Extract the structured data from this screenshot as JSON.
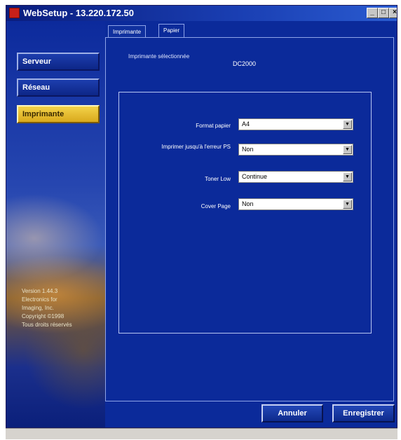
{
  "window": {
    "title": "WebSetup - 13.220.172.50",
    "controls": [
      "_",
      "□",
      "×"
    ]
  },
  "sidebar": {
    "items": [
      {
        "label": "Serveur",
        "active": false
      },
      {
        "label": "Réseau",
        "active": false
      },
      {
        "label": "Imprimante",
        "active": true
      }
    ],
    "info_lines": [
      "Version 1.44.3",
      "Electronics for",
      "Imaging, Inc.",
      "Copyright ©1998",
      "Tous droits réservés"
    ]
  },
  "tabs": [
    {
      "label": "Imprimante",
      "active": false
    },
    {
      "label": "Papier",
      "active": true
    }
  ],
  "printer": {
    "label": "Imprimante sélectionnée",
    "value": "DC2000"
  },
  "fields": [
    {
      "label": "Format papier",
      "value": "A4"
    },
    {
      "label": "Imprimer jusqu'à l'erreur PS",
      "value": "Non"
    },
    {
      "label": "Toner Low",
      "value": "Continue"
    },
    {
      "label": "Cover Page",
      "value": "Non"
    }
  ],
  "buttons": {
    "cancel": "Annuler",
    "save": "Enregistrer"
  },
  "colors": {
    "window_bg": "#0b2a9a",
    "active_nav": "#e6bd2e",
    "panel_border": "#8ea3e8"
  },
  "icons": {
    "dropdown_arrow": "chevron-down-icon",
    "app": "app-icon"
  }
}
